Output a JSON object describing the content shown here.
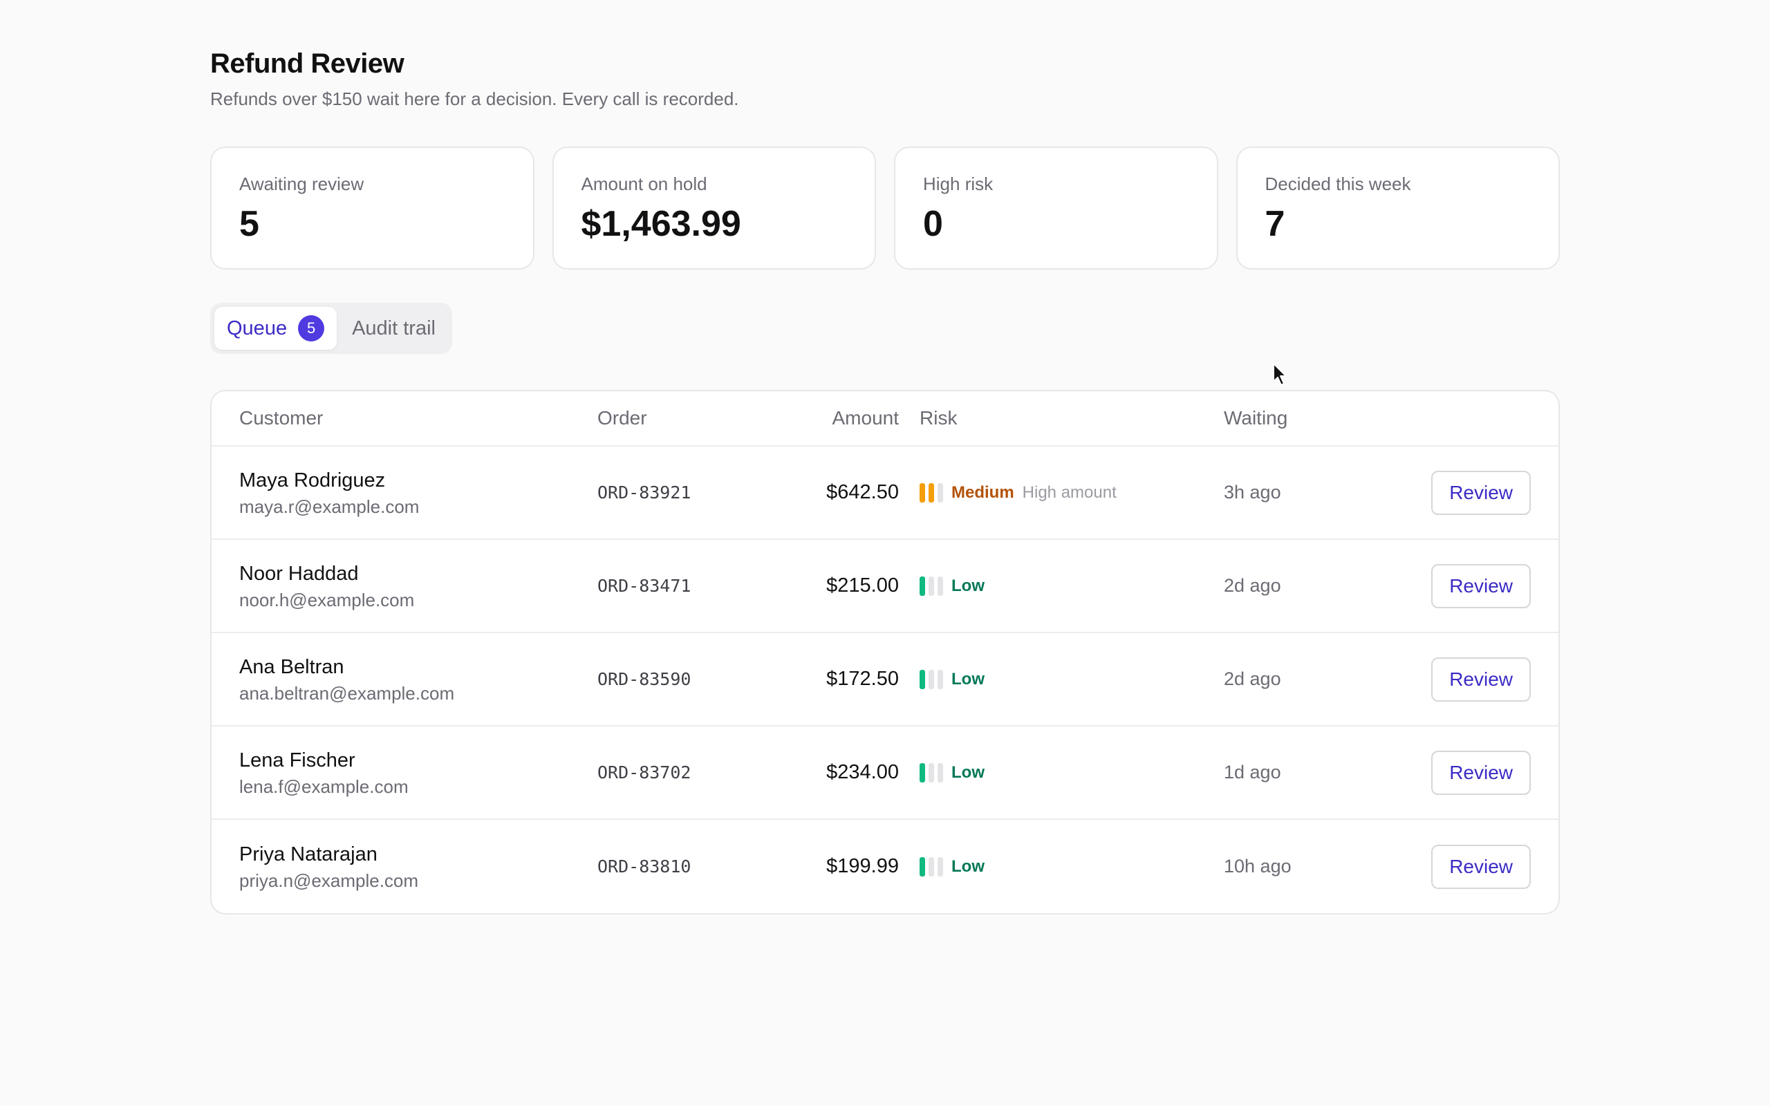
{
  "header": {
    "title": "Refund Review",
    "subtitle": "Refunds over $150 wait here for a decision. Every call is recorded."
  },
  "stats": [
    {
      "label": "Awaiting review",
      "value": "5"
    },
    {
      "label": "Amount on hold",
      "value": "$1,463.99"
    },
    {
      "label": "High risk",
      "value": "0"
    },
    {
      "label": "Decided this week",
      "value": "7"
    }
  ],
  "tabs": {
    "queue_label": "Queue",
    "queue_count": "5",
    "audit_label": "Audit trail",
    "active": "queue"
  },
  "table": {
    "columns": {
      "customer": "Customer",
      "order": "Order",
      "amount": "Amount",
      "risk": "Risk",
      "waiting": "Waiting"
    },
    "rows": [
      {
        "name": "Maya Rodriguez",
        "email": "maya.r@example.com",
        "order": "ORD-83921",
        "amount": "$642.50",
        "risk_level": "Medium",
        "risk_bars_filled": 2,
        "risk_note": "High amount",
        "waiting": "3h ago",
        "action": "Review"
      },
      {
        "name": "Noor Haddad",
        "email": "noor.h@example.com",
        "order": "ORD-83471",
        "amount": "$215.00",
        "risk_level": "Low",
        "risk_bars_filled": 1,
        "risk_note": "",
        "waiting": "2d ago",
        "action": "Review"
      },
      {
        "name": "Ana Beltran",
        "email": "ana.beltran@example.com",
        "order": "ORD-83590",
        "amount": "$172.50",
        "risk_level": "Low",
        "risk_bars_filled": 1,
        "risk_note": "",
        "waiting": "2d ago",
        "action": "Review"
      },
      {
        "name": "Lena Fischer",
        "email": "lena.f@example.com",
        "order": "ORD-83702",
        "amount": "$234.00",
        "risk_level": "Low",
        "risk_bars_filled": 1,
        "risk_note": "",
        "waiting": "1d ago",
        "action": "Review"
      },
      {
        "name": "Priya Natarajan",
        "email": "priya.n@example.com",
        "order": "ORD-83810",
        "amount": "$199.99",
        "risk_level": "Low",
        "risk_bars_filled": 1,
        "risk_note": "",
        "waiting": "10h ago",
        "action": "Review"
      }
    ]
  },
  "colors": {
    "accent": "#3b2bc5",
    "badge": "#4f3be0",
    "risk_medium": "#f59e0b",
    "risk_medium_text": "#b45309",
    "risk_low": "#10b981",
    "risk_low_text": "#047857",
    "risk_empty": "#e4e4e7"
  }
}
